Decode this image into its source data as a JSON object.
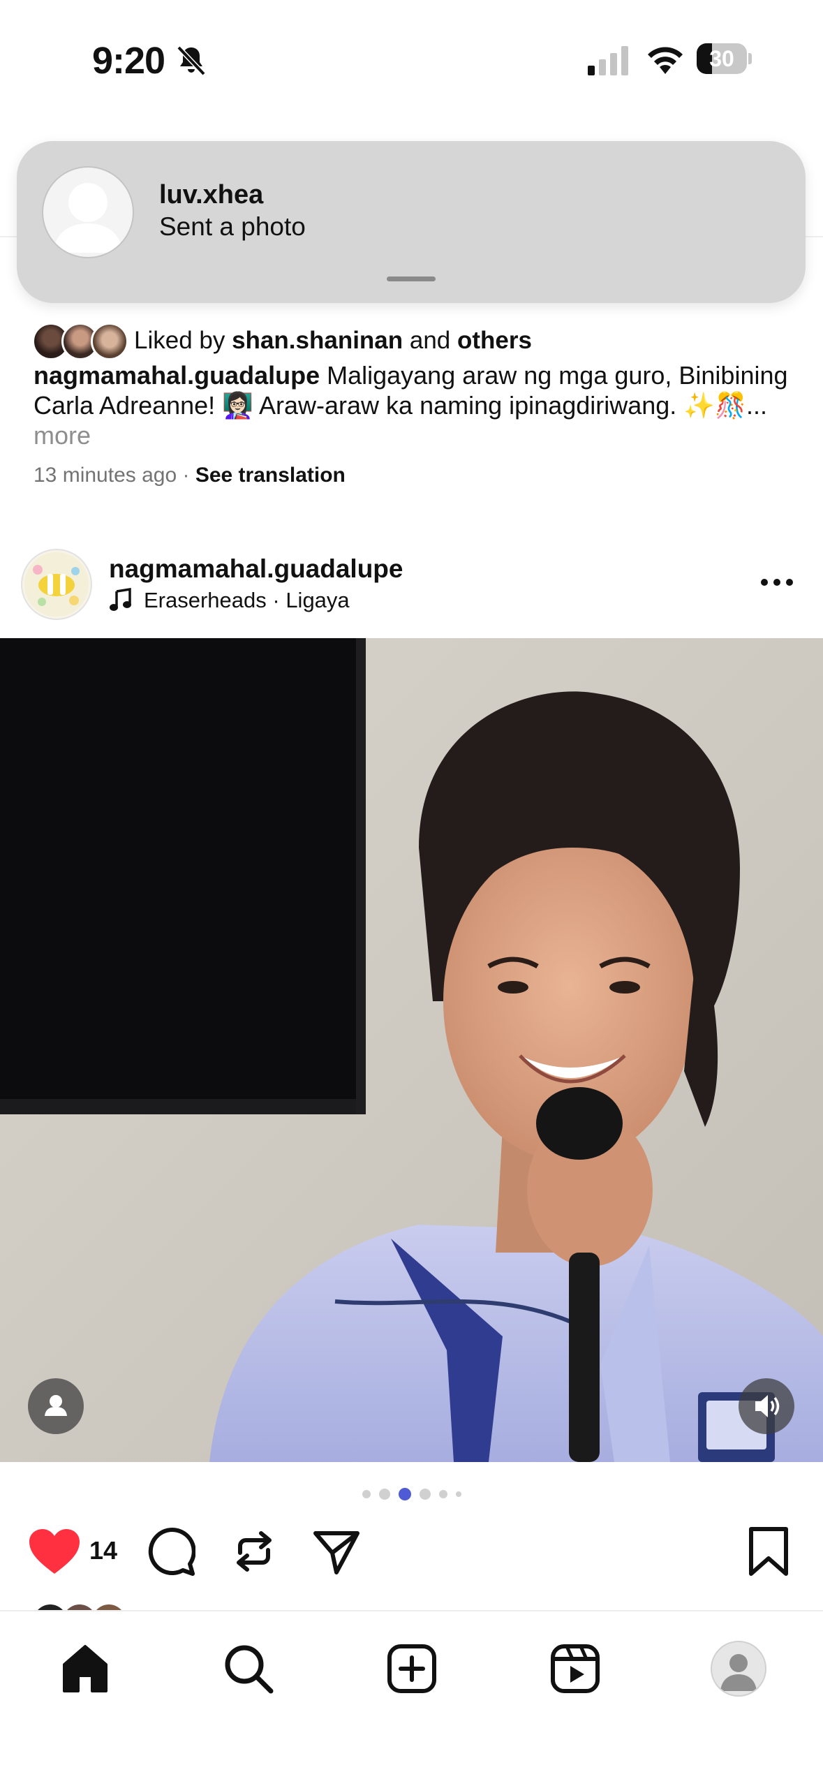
{
  "status_bar": {
    "time": "9:20",
    "battery_percent": 30,
    "battery_label": "30",
    "bell_muted": true
  },
  "notification": {
    "username": "luv.xhea",
    "message": "Sent a photo"
  },
  "previous_post": {
    "liked_by_prefix": "Liked by ",
    "liked_by_user": "shan.shaninan",
    "liked_by_and": " and ",
    "liked_by_others": "others",
    "caption_user": "nagmamahal.guadalupe",
    "caption_text": " Maligayang araw ng mga guro, Binibining Carla Adreanne! 👩🏻‍🏫 Araw-araw ka naming ipinagdiriwang. ✨🎊",
    "caption_ellipsis": "... ",
    "caption_more": "more",
    "time_ago": "13 minutes ago",
    "meta_separator": " · ",
    "see_translation": "See translation"
  },
  "post": {
    "username": "nagmamahal.guadalupe",
    "song": "Eraserheads · Ligaya",
    "carousel_total": 6,
    "carousel_active": 3,
    "like_count": "14",
    "liked": true
  },
  "colors": {
    "like_red": "#ff3040",
    "carousel_active": "#4f5bd5",
    "notification_bg": "#d6d6d6",
    "muted_text": "#737373"
  },
  "tab_bar": {
    "tabs": [
      "home-icon",
      "search-icon",
      "create-icon",
      "reels-icon",
      "profile-avatar"
    ],
    "active": "home-icon"
  }
}
